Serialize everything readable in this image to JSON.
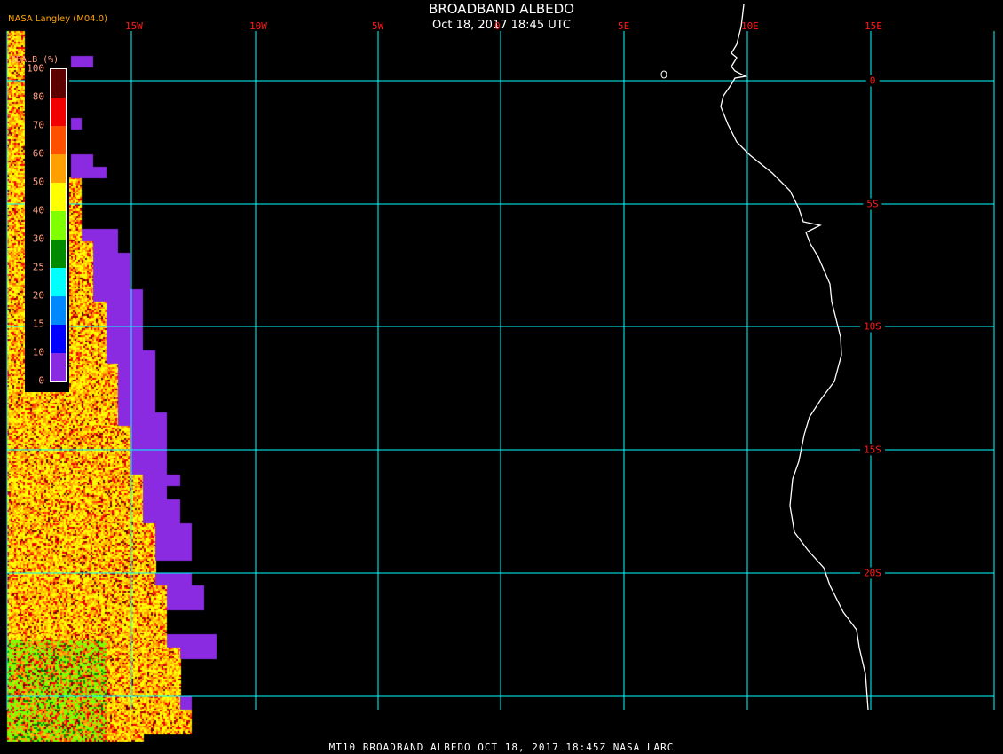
{
  "header": {
    "title": "BROADBAND ALBEDO",
    "subtitle": "Oct 18, 2017 18:45 UTC",
    "source": "NASA Langley (M04.0)"
  },
  "footer": "MT10  BROADBAND ALBEDO   OCT 18, 2017 18:45Z   NASA LARC",
  "map": {
    "longitude_labels": [
      "15W",
      "10W",
      "5W",
      "0",
      "5E",
      "10E",
      "15E"
    ],
    "latitude_labels": [
      "0",
      "5S",
      "10S",
      "15S",
      "20S"
    ],
    "grid_color": "#00ffff",
    "label_color": "#ff1a1a",
    "coastline_color": "#ffffff"
  },
  "legend": {
    "title": "BBALB (%)",
    "ticks": [
      "100",
      "80",
      "70",
      "60",
      "50",
      "40",
      "30",
      "25",
      "20",
      "15",
      "10",
      "0"
    ],
    "colors": [
      "#5c0000",
      "#f00000",
      "#ff5000",
      "#ffa000",
      "#ffff00",
      "#80ff00",
      "#008a00",
      "#00ffff",
      "#0088ff",
      "#0000ff",
      "#8a2be2"
    ]
  }
}
